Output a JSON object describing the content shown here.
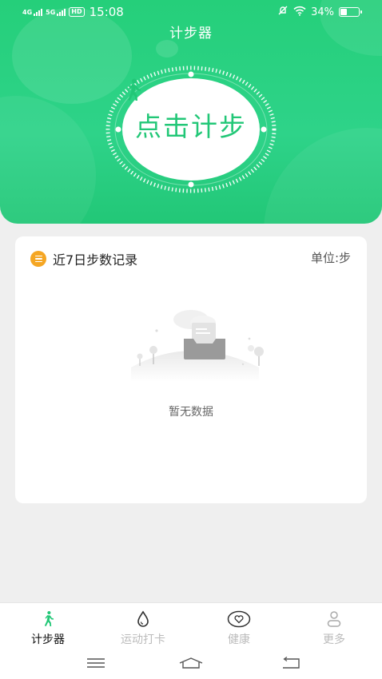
{
  "status_bar": {
    "signal_1": "4G",
    "signal_2": "5G",
    "hd": "HD",
    "time": "15:08",
    "battery": "34%"
  },
  "header": {
    "title": "计步器"
  },
  "step_button": {
    "label": "点击计步"
  },
  "record_card": {
    "title": "近7日步数记录",
    "unit": "单位:步",
    "empty_text": "暂无数据"
  },
  "tabs": [
    {
      "label": "计步器",
      "icon": "walker-icon",
      "active": true
    },
    {
      "label": "运动打卡",
      "icon": "drop-icon",
      "active": false
    },
    {
      "label": "健康",
      "icon": "heart-icon",
      "active": false
    },
    {
      "label": "更多",
      "icon": "person-icon",
      "active": false
    }
  ],
  "colors": {
    "brand_green": "#25cf7a",
    "accent_orange": "#f5a623",
    "inactive_gray": "#bbbbbb"
  }
}
